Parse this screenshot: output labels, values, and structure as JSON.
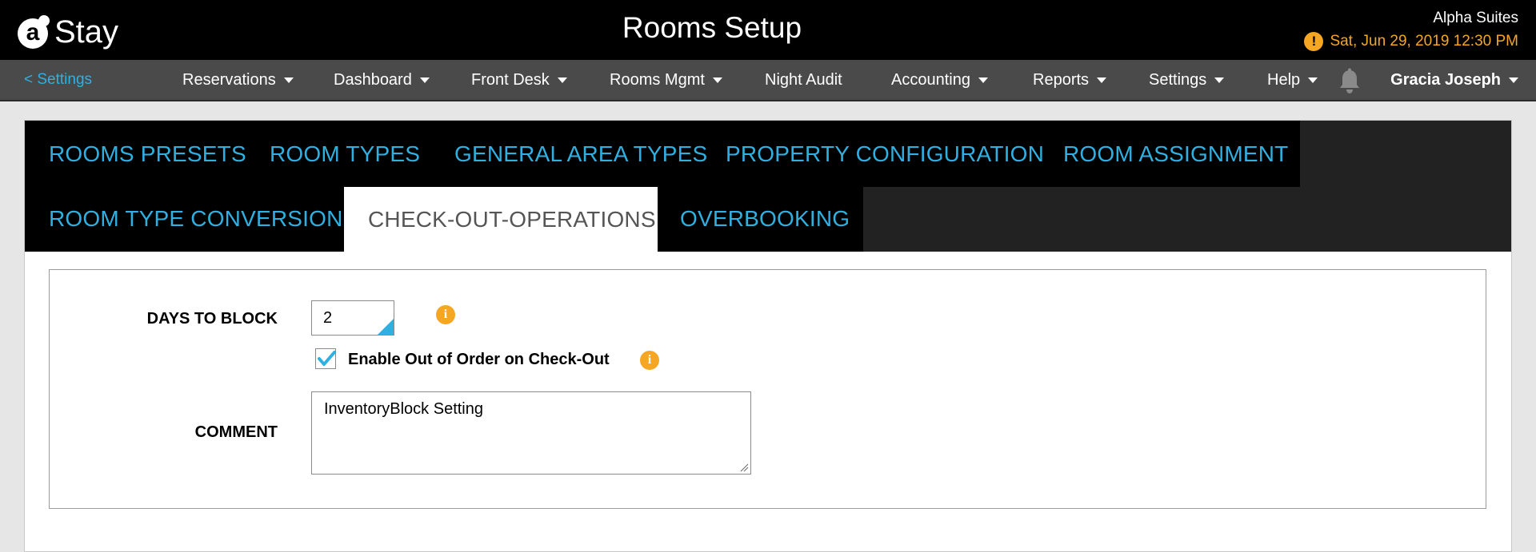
{
  "header": {
    "logo_letter": "a",
    "logo_text": "Stay",
    "title": "Rooms Setup",
    "property_name": "Alpha Suites",
    "datetime": "Sat, Jun 29, 2019 12:30 PM",
    "warning_glyph": "!"
  },
  "nav": {
    "back_label": "< Settings",
    "items": [
      {
        "label": "Reservations",
        "dropdown": true
      },
      {
        "label": "Dashboard",
        "dropdown": true
      },
      {
        "label": "Front Desk",
        "dropdown": true
      },
      {
        "label": "Rooms Mgmt",
        "dropdown": true
      },
      {
        "label": "Night Audit",
        "dropdown": false
      },
      {
        "label": "Accounting",
        "dropdown": true
      },
      {
        "label": "Reports",
        "dropdown": true
      },
      {
        "label": "Settings",
        "dropdown": true
      },
      {
        "label": "Help",
        "dropdown": true
      }
    ],
    "notification_icon": "bell-icon",
    "user_name": "Gracia Joseph"
  },
  "tabs": [
    {
      "label": "ROOMS PRESETS",
      "active": false
    },
    {
      "label": "ROOM TYPES",
      "active": false
    },
    {
      "label": "GENERAL AREA TYPES",
      "active": false
    },
    {
      "label": "PROPERTY CONFIGURATION",
      "active": false
    },
    {
      "label": "ROOM ASSIGNMENT",
      "active": false
    },
    {
      "label": "ROOM TYPE CONVERSION",
      "active": false
    },
    {
      "label": "CHECK-OUT-OPERATIONS",
      "active": true
    },
    {
      "label": "OVERBOOKING",
      "active": false
    }
  ],
  "form": {
    "days_to_block_label": "DAYS TO BLOCK",
    "days_to_block_value": "2",
    "info_glyph": "i",
    "enable_ooo_label": "Enable Out of Order on Check-Out",
    "enable_ooo_checked": true,
    "comment_label": "COMMENT",
    "comment_value": "InventoryBlock Setting"
  },
  "colors": {
    "accent_blue": "#2fb0e0",
    "warning_orange": "#f5a623",
    "header_bg": "#000000",
    "nav_bg": "#4a4a4a"
  }
}
